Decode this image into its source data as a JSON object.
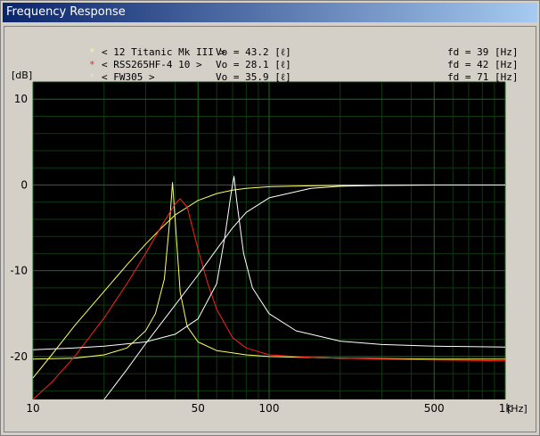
{
  "window": {
    "title": "Frequency Response"
  },
  "legend": [
    {
      "marker": "*",
      "color": "#ffff66",
      "name": "< 12 Titanic Mk III >",
      "vo": "Vo = 43.2 [ℓ]",
      "fd": "fd = 39 [Hz]"
    },
    {
      "marker": "*",
      "color": "#ff2020",
      "name": "< RSS265HF-4 10 >",
      "vo": "Vo = 28.1 [ℓ]",
      "fd": "fd = 42 [Hz]"
    },
    {
      "marker": "*",
      "color": "#ffffff",
      "name": "< FW305 >",
      "vo": "Vo = 35.9 [ℓ]",
      "fd": "fd = 71 [Hz]"
    }
  ],
  "chart_data": {
    "type": "line",
    "title": "Frequency Response",
    "xlabel": "[Hz]",
    "ylabel": "[dB]",
    "xscale": "log",
    "xlim": [
      10,
      1000
    ],
    "ylim": [
      -25,
      12
    ],
    "yticks": [
      10,
      0,
      -10,
      -20
    ],
    "ytick_labels": [
      "10",
      "0",
      "-10",
      "-20"
    ],
    "xticks": [
      10,
      50,
      100,
      500,
      1000
    ],
    "xtick_labels": [
      "10",
      "50",
      "100",
      "500",
      "1k"
    ],
    "grid": true,
    "background": "#000000",
    "grid_color": "#1e6a1e",
    "series": [
      {
        "name": "< 12 Titanic Mk III >",
        "kind": "resp",
        "color": "#ffff66",
        "x": [
          10,
          12,
          15,
          20,
          25,
          30,
          35,
          40,
          45,
          50,
          60,
          70,
          80,
          100,
          150,
          200,
          300,
          500,
          700,
          1000
        ],
        "y": [
          -22.5,
          -19.8,
          -16.4,
          -12.4,
          -9.3,
          -6.9,
          -5.0,
          -3.5,
          -2.6,
          -1.8,
          -1.0,
          -0.6,
          -0.4,
          -0.2,
          -0.1,
          -0.05,
          -0.02,
          0,
          0,
          0
        ]
      },
      {
        "name": "< 12 Titanic Mk III >",
        "kind": "imp",
        "color": "#ffff66",
        "x": [
          10,
          15,
          20,
          25,
          30,
          33,
          36,
          38,
          39,
          40,
          42,
          45,
          50,
          60,
          80,
          100,
          200,
          500,
          1000
        ],
        "y": [
          -20.3,
          -20.2,
          -19.8,
          -19.0,
          -17.0,
          -15.0,
          -11.0,
          -4.0,
          0.3,
          -4.0,
          -12.5,
          -16.5,
          -18.3,
          -19.3,
          -19.8,
          -20.0,
          -20.2,
          -20.3,
          -20.3
        ]
      },
      {
        "name": "< RSS265HF-4 10 >",
        "kind": "resp",
        "color": "#ff2020",
        "x": [
          10,
          12,
          15,
          20,
          25,
          30,
          35,
          40,
          42,
          45,
          50,
          55,
          60,
          70,
          80,
          100,
          150,
          200,
          300,
          500,
          1000
        ],
        "y": [
          -25.0,
          -23.0,
          -20.0,
          -15.5,
          -11.5,
          -8.0,
          -4.8,
          -2.2,
          -1.6,
          -2.6,
          -7.5,
          -11.5,
          -14.5,
          -17.8,
          -19.0,
          -19.8,
          -20.1,
          -20.2,
          -20.3,
          -20.4,
          -20.5
        ]
      },
      {
        "name": "< FW305 >",
        "kind": "resp",
        "color": "#ffffff",
        "x": [
          20,
          25,
          30,
          40,
          50,
          60,
          70,
          80,
          100,
          150,
          200,
          300,
          500,
          700,
          1000
        ],
        "y": [
          -25.0,
          -21.5,
          -18.5,
          -14.0,
          -10.5,
          -7.5,
          -5.0,
          -3.2,
          -1.5,
          -0.4,
          -0.15,
          -0.05,
          0,
          0,
          0
        ]
      },
      {
        "name": "< FW305 >",
        "kind": "imp",
        "color": "#ffffff",
        "x": [
          10,
          15,
          20,
          30,
          40,
          50,
          60,
          65,
          69,
          71,
          73,
          78,
          85,
          100,
          130,
          200,
          300,
          500,
          1000
        ],
        "y": [
          -19.2,
          -19.0,
          -18.8,
          -18.3,
          -17.4,
          -15.6,
          -11.5,
          -6.0,
          -1.0,
          1.0,
          -2.0,
          -8.0,
          -12.0,
          -15.0,
          -17.0,
          -18.2,
          -18.6,
          -18.8,
          -18.9
        ]
      }
    ]
  }
}
